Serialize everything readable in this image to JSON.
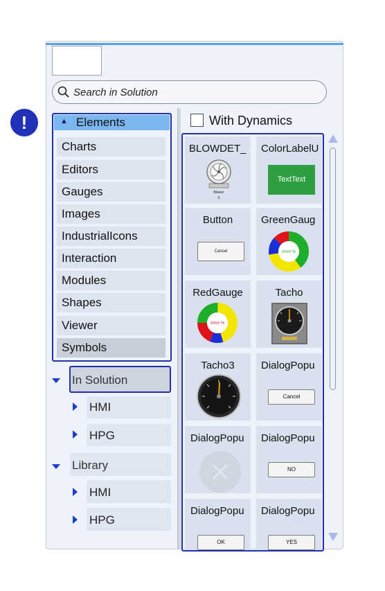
{
  "search": {
    "placeholder": "Search in Solution"
  },
  "alert": {
    "symbol": "!"
  },
  "elements": {
    "header": "Elements",
    "items": [
      {
        "label": "Charts"
      },
      {
        "label": "Editors"
      },
      {
        "label": "Gauges"
      },
      {
        "label": "Images"
      },
      {
        "label": "IndustrialIcons"
      },
      {
        "label": "Interaction"
      },
      {
        "label": "Modules"
      },
      {
        "label": "Shapes"
      },
      {
        "label": "Viewer"
      },
      {
        "label": "Symbols"
      }
    ]
  },
  "tree": {
    "in_solution": "In Solution",
    "in_solution_children": [
      "HMI",
      "HPG"
    ],
    "library": "Library",
    "library_children": [
      "HMI",
      "HPG"
    ]
  },
  "dynamics": {
    "label": "With Dynamics",
    "checked": false
  },
  "cards": [
    {
      "title": "BLOWDET_",
      "preview_caption": "Blower",
      "preview_value": "0"
    },
    {
      "title": "ColorLabelU",
      "preview_text": "TextText"
    },
    {
      "title": "Button",
      "preview_text": "Cancel"
    },
    {
      "title": "GreenGaug",
      "preview_text": "#### %"
    },
    {
      "title": "RedGauge",
      "preview_text": "#### %"
    },
    {
      "title": "Tacho"
    },
    {
      "title": "Tacho3"
    },
    {
      "title": "DialogPopu",
      "preview_text": "Cancel"
    },
    {
      "title": "DialogPopu"
    },
    {
      "title": "DialogPopu",
      "preview_text": "NO"
    },
    {
      "title": "DialogPopu",
      "preview_text": "OK"
    },
    {
      "title": "DialogPopu",
      "preview_text": "YES"
    }
  ],
  "colors": {
    "accent": "#2130a8",
    "header_blue": "#7ab6ef",
    "green_label": "#2ea043",
    "gauge_green": "#1fae2a",
    "gauge_red": "#e0131a",
    "gauge_yellow": "#f2e600",
    "gauge_blue": "#1d2fd6"
  }
}
